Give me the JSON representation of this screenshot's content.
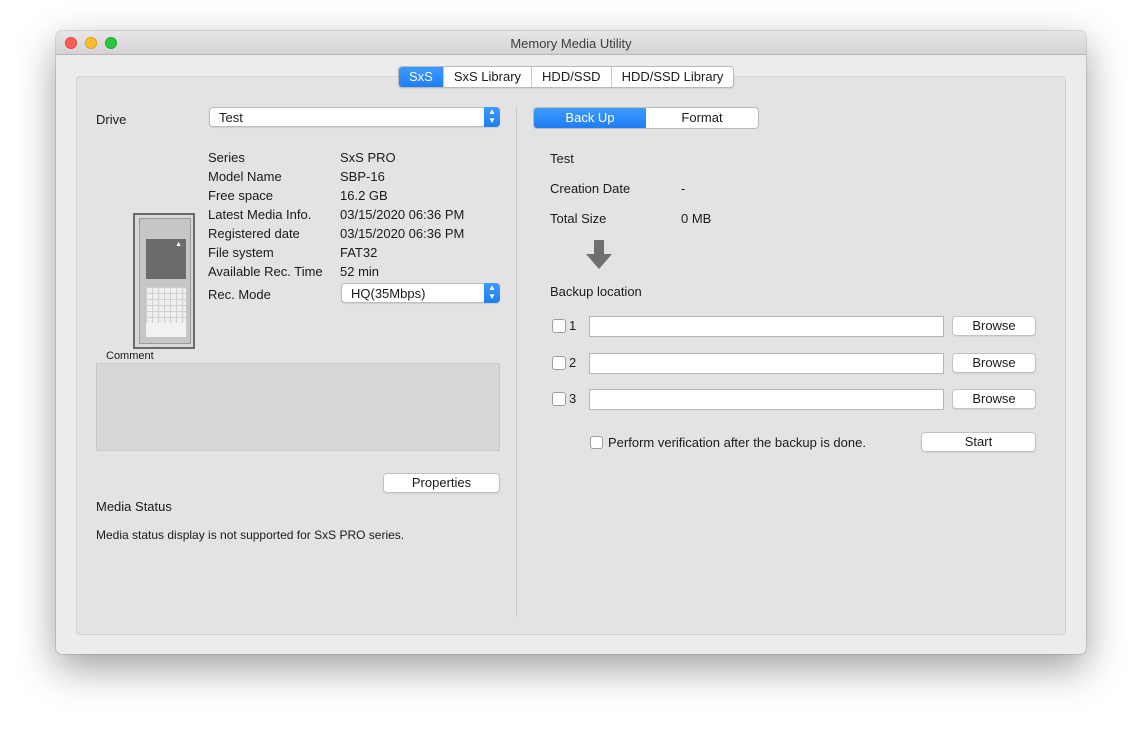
{
  "window": {
    "title": "Memory Media Utility"
  },
  "tabs": [
    "SxS",
    "SxS Library",
    "HDD/SSD",
    "HDD/SSD Library"
  ],
  "left": {
    "drive_label": "Drive",
    "drive_value": "Test",
    "info": [
      {
        "label": "Series",
        "value": "SxS PRO"
      },
      {
        "label": "Model Name",
        "value": "SBP-16"
      },
      {
        "label": "Free space",
        "value": "16.2 GB"
      },
      {
        "label": "Latest Media Info.",
        "value": "03/15/2020 06:36 PM"
      },
      {
        "label": "Registered date",
        "value": "03/15/2020 06:36 PM"
      },
      {
        "label": "File system",
        "value": "FAT32"
      },
      {
        "label": "Available Rec. Time",
        "value": "52 min"
      }
    ],
    "rec_mode_label": "Rec. Mode",
    "rec_mode_value": "HQ(35Mbps)",
    "comment_label": "Comment",
    "properties_button": "Properties",
    "media_status_title": "Media Status",
    "media_status_text": "Media status display is not supported for SxS PRO series."
  },
  "right": {
    "segments": [
      "Back Up",
      "Format"
    ],
    "source_name": "Test",
    "creation_date_label": "Creation Date",
    "creation_date_value": "-",
    "total_size_label": "Total Size",
    "total_size_value": "0 MB",
    "backup_location_label": "Backup location",
    "locations": [
      {
        "num": "1",
        "browse": "Browse"
      },
      {
        "num": "2",
        "browse": "Browse"
      },
      {
        "num": "3",
        "browse": "Browse"
      }
    ],
    "verify_label": "Perform verification after the backup is done.",
    "start_button": "Start"
  }
}
